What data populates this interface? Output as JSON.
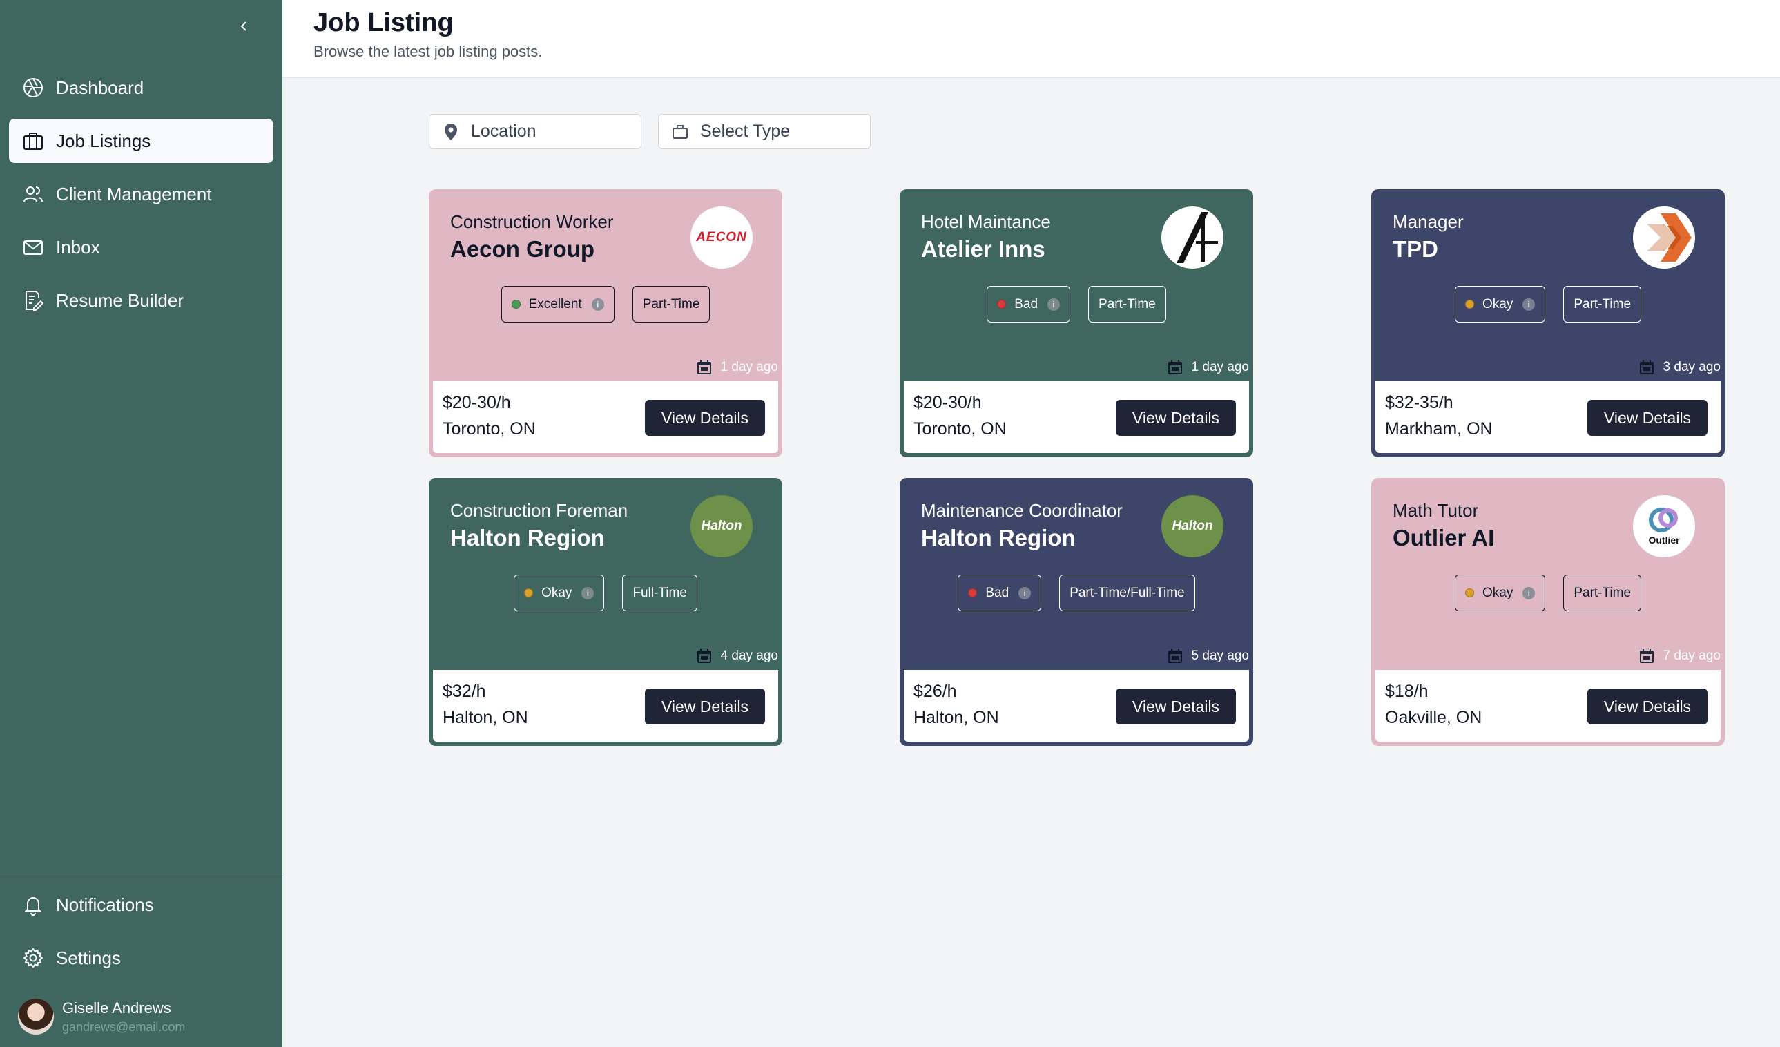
{
  "sidebar": {
    "collapse_icon": "chevron-left-icon",
    "items": [
      {
        "label": "Dashboard",
        "icon": "aperture-icon"
      },
      {
        "label": "Job Listings",
        "icon": "briefcase-icon"
      },
      {
        "label": "Client Management",
        "icon": "users-icon"
      },
      {
        "label": "Inbox",
        "icon": "mail-icon"
      },
      {
        "label": "Resume Builder",
        "icon": "resume-edit-icon"
      }
    ],
    "bottom_items": [
      {
        "label": "Notifications",
        "icon": "bell-icon"
      },
      {
        "label": "Settings",
        "icon": "gear-icon"
      }
    ],
    "user": {
      "name": "Giselle Andrews",
      "email": "gandrews@email.com"
    }
  },
  "header": {
    "title": "Job Listing",
    "subtitle": "Browse the latest job listing posts."
  },
  "filters": {
    "location": "Location",
    "type": "Select Type"
  },
  "colors": {
    "sidebar_bg": "#3f665f",
    "card_pink": "#dfb8c4",
    "card_green": "#3f665f",
    "card_navy": "#3d4668",
    "button_dark": "#1f2436",
    "rating_excellent": "#4c9a55",
    "rating_bad": "#d83b3b",
    "rating_okay": "#d9a12a"
  },
  "cards": [
    {
      "title": "Construction Worker",
      "company": "Aecon Group",
      "rating": "Excellent",
      "type": "Part-Time",
      "posted": "1 day ago",
      "salary": "$20-30/h",
      "location": "Toronto, ON",
      "button": "View Details",
      "logo_text": "AECON"
    },
    {
      "title": "Hotel Maintance",
      "company": "Atelier Inns",
      "rating": "Bad",
      "type": "Part-Time",
      "posted": "1 day ago",
      "salary": "$20-30/h",
      "location": "Toronto, ON",
      "button": "View Details",
      "logo_text": "A"
    },
    {
      "title": "Manager",
      "company": "TPD",
      "rating": "Okay",
      "type": "Part-Time",
      "posted": "3 day ago",
      "salary": "$32-35/h",
      "location": "Markham, ON",
      "button": "View Details",
      "logo_text": ""
    },
    {
      "title": "Construction Foreman",
      "company": "Halton Region",
      "rating": "Okay",
      "type": "Full-Time",
      "posted": "4 day ago",
      "salary": "$32/h",
      "location": "Halton, ON",
      "button": "View Details",
      "logo_text": "Halton"
    },
    {
      "title": "Maintenance Coordinator",
      "company": "Halton Region",
      "rating": "Bad",
      "type": "Part-Time/Full-Time",
      "posted": "5 day ago",
      "salary": "$26/h",
      "location": "Halton, ON",
      "button": "View Details",
      "logo_text": "Halton"
    },
    {
      "title": "Math Tutor",
      "company": "Outlier AI",
      "rating": "Okay",
      "type": "Part-Time",
      "posted": "7 day ago",
      "salary": "$18/h",
      "location": "Oakville, ON",
      "button": "View Details",
      "logo_text": "Outlier"
    }
  ]
}
